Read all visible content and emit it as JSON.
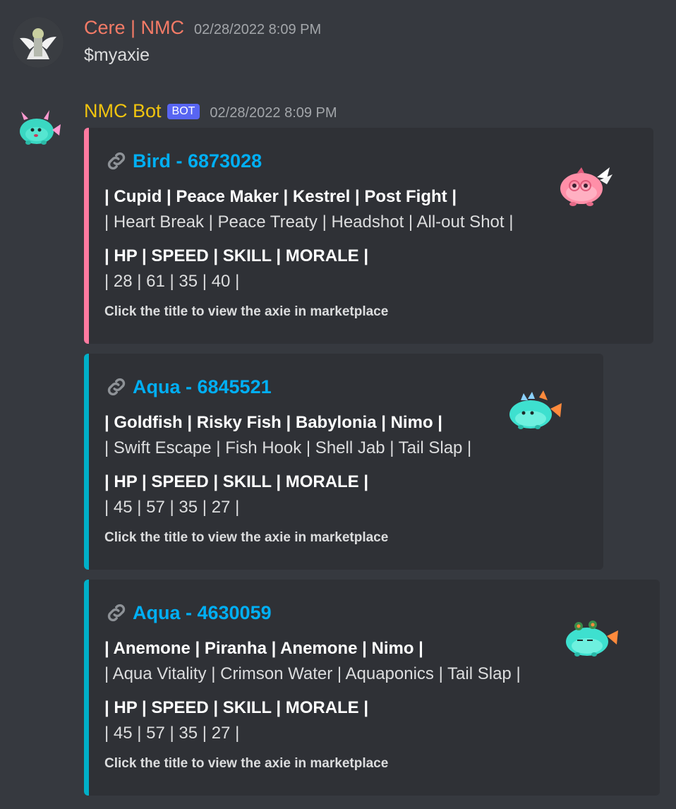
{
  "messages": [
    {
      "username": "Cere | NMC",
      "username_color": "#f47b67",
      "timestamp": "02/28/2022 8:09 PM",
      "content": "$myaxie"
    },
    {
      "username": "NMC Bot",
      "username_color": "#f1c40f",
      "badge": "BOT",
      "timestamp": "02/28/2022 8:09 PM",
      "embeds": [
        {
          "title": "Bird - 6873028",
          "accent": "#ff7aa0",
          "parts": "| Cupid | Peace Maker | Kestrel | Post Fight |",
          "abilities": "| Heart Break | Peace Treaty | Headshot | All-out Shot |",
          "stats_header": "| HP | SPEED | SKILL | MORALE |",
          "stats": "| 28 | 61 | 35 | 40 |",
          "footer": "Click the title to view the axie in marketplace",
          "thumbnail": "pink-bird-axie"
        },
        {
          "title": "Aqua - 6845521",
          "accent": "#00b0c8",
          "parts": "| Goldfish | Risky Fish | Babylonia | Nimo |",
          "abilities": "| Swift Escape | Fish Hook | Shell Jab | Tail Slap |",
          "stats_header": "| HP | SPEED | SKILL | MORALE |",
          "stats": "| 45 | 57 | 35 | 27 |",
          "footer": "Click the title to view the axie in marketplace",
          "thumbnail": "aqua-axie"
        },
        {
          "title": "Aqua - 4630059",
          "accent": "#00b0c8",
          "parts": "| Anemone | Piranha | Anemone | Nimo |",
          "abilities": "| Aqua Vitality | Crimson Water | Aquaponics | Tail Slap |",
          "stats_header": "| HP | SPEED | SKILL | MORALE |",
          "stats": "| 45 | 57 | 35 | 27 |",
          "footer": "Click the title to view the axie in marketplace",
          "thumbnail": "aqua-axie"
        }
      ]
    }
  ]
}
